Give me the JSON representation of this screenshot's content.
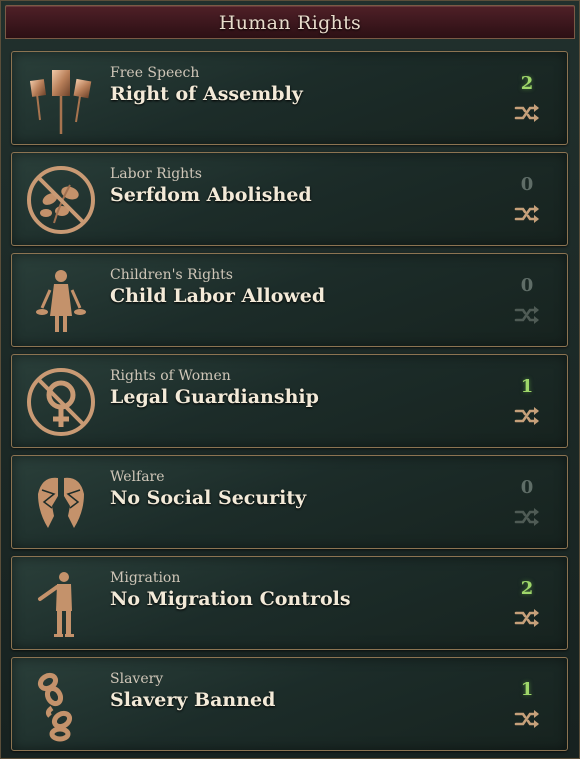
{
  "window": {
    "title": "Human Rights"
  },
  "colors": {
    "accent_active": "#9fd66a",
    "accent_inactive": "#5f6d67",
    "title_bar": "#4f2027",
    "border": "#8c7452"
  },
  "rows": [
    {
      "category": "Free Speech",
      "law": "Right of Assembly",
      "count": "2",
      "active": true,
      "icon": "banners-icon"
    },
    {
      "category": "Labor Rights",
      "law": "Serfdom Abolished",
      "count": "0",
      "active": false,
      "swap_enabled": true,
      "icon": "no-flowers-icon"
    },
    {
      "category": "Children's Rights",
      "law": "Child Labor Allowed",
      "count": "0",
      "active": false,
      "swap_enabled": false,
      "icon": "child-worker-icon"
    },
    {
      "category": "Rights of Women",
      "law": "Legal Guardianship",
      "count": "1",
      "active": true,
      "icon": "no-female-symbol-icon"
    },
    {
      "category": "Welfare",
      "law": "No Social Security",
      "count": "0",
      "active": false,
      "swap_enabled": false,
      "icon": "broken-wings-icon"
    },
    {
      "category": "Migration",
      "law": "No Migration Controls",
      "count": "2",
      "active": true,
      "icon": "migrant-figure-icon"
    },
    {
      "category": "Slavery",
      "law": "Slavery Banned",
      "count": "1",
      "active": true,
      "icon": "broken-chain-icon"
    }
  ]
}
